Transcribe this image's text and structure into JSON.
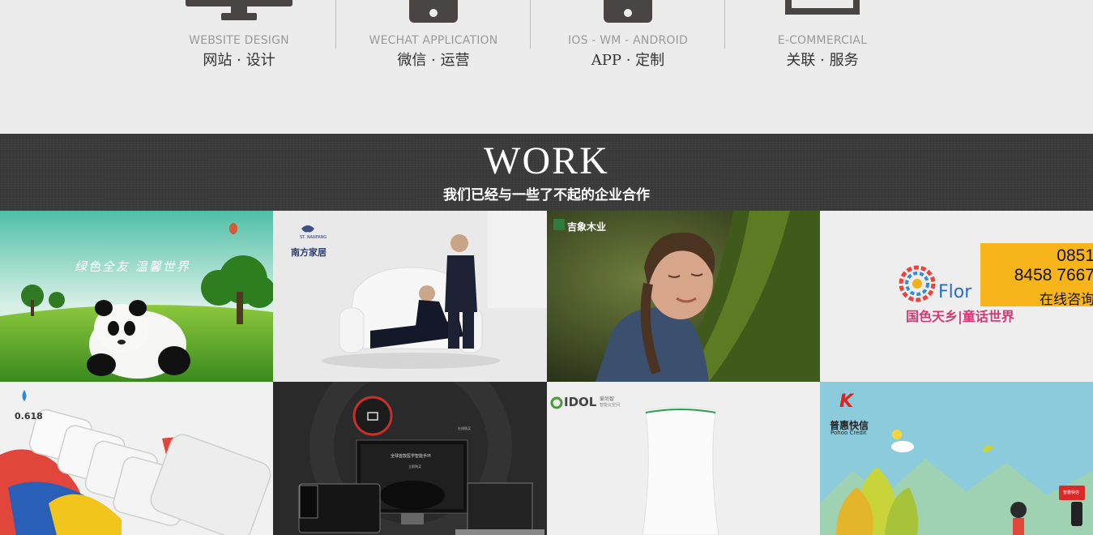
{
  "services": [
    {
      "en": "WEBSITE DESIGN",
      "cn": "网站 · 设计",
      "icon": "monitor-icon"
    },
    {
      "en": "WECHAT APPLICATION",
      "cn": "微信 · 运营",
      "icon": "phone-icon"
    },
    {
      "en": "IOS - WM - ANDROID",
      "cn": "APP · 定制",
      "icon": "smartphone-icon"
    },
    {
      "en": "E-COMMERCIAL",
      "cn": "关联 · 服务",
      "icon": "shop-icon"
    }
  ],
  "work": {
    "title": "WORK",
    "subtitle": "我们已经与一些了不起的企业合作"
  },
  "portfolio": [
    {
      "caption": "绿色全友  温馨世界"
    },
    {
      "brand": "南方家居",
      "brand_small": "ST. NANFANG"
    },
    {
      "brand": "吉象木业"
    },
    {
      "brand_latin": "Flor",
      "slogan": "国色天乡|童话世界"
    },
    {
      "brand": "0.618"
    },
    {
      "screen_text": "全球首款医学智能手环",
      "screen_btn": "立即购买",
      "side_text": "在线购买"
    },
    {
      "brand": "IDOL",
      "brand_cn": "爱尚智",
      "brand_small": "智能云空间"
    },
    {
      "brand": "普惠快信",
      "brand_small": "Pohoo Credit",
      "brand_mark": "K",
      "corner_text": "普惠快信"
    }
  ],
  "contact": {
    "line1": "0851",
    "line2": "8458 7667",
    "line3": "在线咨询"
  },
  "colors": {
    "banner": "#3c3b3b",
    "accent": "#f7b51b",
    "icon": "#4a4545"
  }
}
